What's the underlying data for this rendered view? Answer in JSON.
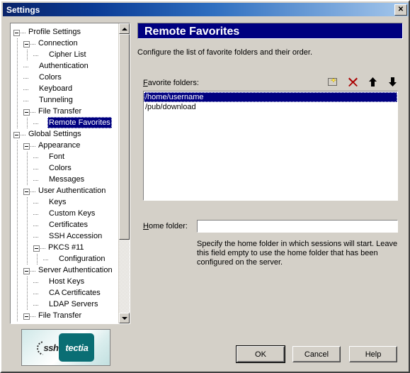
{
  "window": {
    "title": "Settings",
    "close_icon": "close-icon",
    "close_glyph": "✕"
  },
  "tree": {
    "nodes": [
      {
        "label": "Profile Settings",
        "depth": 0,
        "expander": "minus",
        "selected": false
      },
      {
        "label": "Connection",
        "depth": 1,
        "expander": "minus",
        "selected": false
      },
      {
        "label": "Cipher List",
        "depth": 2,
        "expander": "none",
        "selected": false
      },
      {
        "label": "Authentication",
        "depth": 1,
        "expander": "none",
        "selected": false
      },
      {
        "label": "Colors",
        "depth": 1,
        "expander": "none",
        "selected": false
      },
      {
        "label": "Keyboard",
        "depth": 1,
        "expander": "none",
        "selected": false
      },
      {
        "label": "Tunneling",
        "depth": 1,
        "expander": "none",
        "selected": false
      },
      {
        "label": "File Transfer",
        "depth": 1,
        "expander": "minus",
        "selected": false
      },
      {
        "label": "Remote Favorites",
        "depth": 2,
        "expander": "none",
        "selected": true
      },
      {
        "label": "Global Settings",
        "depth": 0,
        "expander": "minus",
        "selected": false
      },
      {
        "label": "Appearance",
        "depth": 1,
        "expander": "minus",
        "selected": false
      },
      {
        "label": "Font",
        "depth": 2,
        "expander": "none",
        "selected": false
      },
      {
        "label": "Colors",
        "depth": 2,
        "expander": "none",
        "selected": false
      },
      {
        "label": "Messages",
        "depth": 2,
        "expander": "none",
        "selected": false
      },
      {
        "label": "User Authentication",
        "depth": 1,
        "expander": "minus",
        "selected": false
      },
      {
        "label": "Keys",
        "depth": 2,
        "expander": "none",
        "selected": false
      },
      {
        "label": "Custom Keys",
        "depth": 2,
        "expander": "none",
        "selected": false
      },
      {
        "label": "Certificates",
        "depth": 2,
        "expander": "none",
        "selected": false
      },
      {
        "label": "SSH Accession",
        "depth": 2,
        "expander": "none",
        "selected": false
      },
      {
        "label": "PKCS #11",
        "depth": 2,
        "expander": "minus",
        "selected": false
      },
      {
        "label": "Configuration",
        "depth": 3,
        "expander": "none",
        "selected": false
      },
      {
        "label": "Server Authentication",
        "depth": 1,
        "expander": "minus",
        "selected": false
      },
      {
        "label": "Host Keys",
        "depth": 2,
        "expander": "none",
        "selected": false
      },
      {
        "label": "CA Certificates",
        "depth": 2,
        "expander": "none",
        "selected": false
      },
      {
        "label": "LDAP Servers",
        "depth": 2,
        "expander": "none",
        "selected": false
      },
      {
        "label": "File Transfer",
        "depth": 1,
        "expander": "minus",
        "selected": false
      }
    ],
    "scrollbar": {
      "up_icon": "scroll-up-arrow-icon",
      "down_icon": "scroll-down-arrow-icon"
    }
  },
  "page": {
    "header": "Remote Favorites",
    "description": "Configure the list of favorite folders and their order.",
    "favorites": {
      "label": "Favorite folders:",
      "accel": "F",
      "toolbar": [
        {
          "name": "new-folder-icon",
          "title": "New"
        },
        {
          "name": "delete-icon",
          "title": "Delete"
        },
        {
          "name": "move-up-icon",
          "title": "Move Up"
        },
        {
          "name": "move-down-icon",
          "title": "Move Down"
        }
      ],
      "items": [
        {
          "text": "/home/username",
          "selected": true
        },
        {
          "text": "/pub/download",
          "selected": false
        }
      ]
    },
    "home_folder": {
      "label": "Home folder:",
      "accel": "H",
      "value": "",
      "placeholder": "",
      "help": "Specify the home folder in which sessions will start. Leave this field empty to use the home folder that has been configured on the server."
    }
  },
  "footer": {
    "logo": {
      "name": "ssh-tectia-logo",
      "word1": "ssh",
      "word2": "tectia"
    },
    "buttons": [
      {
        "name": "ok-button",
        "label": "OK",
        "default": true
      },
      {
        "name": "cancel-button",
        "label": "Cancel",
        "default": false
      },
      {
        "name": "help-button",
        "label": "Help",
        "default": false
      }
    ]
  },
  "colors": {
    "face": "#d4d0c8",
    "title_start": "#0a246a",
    "title_end": "#a6c8ec",
    "header_bg": "#000080",
    "selection": "#000080",
    "delete_x": "#aa0000",
    "logo_teal": "#0a6e74"
  }
}
